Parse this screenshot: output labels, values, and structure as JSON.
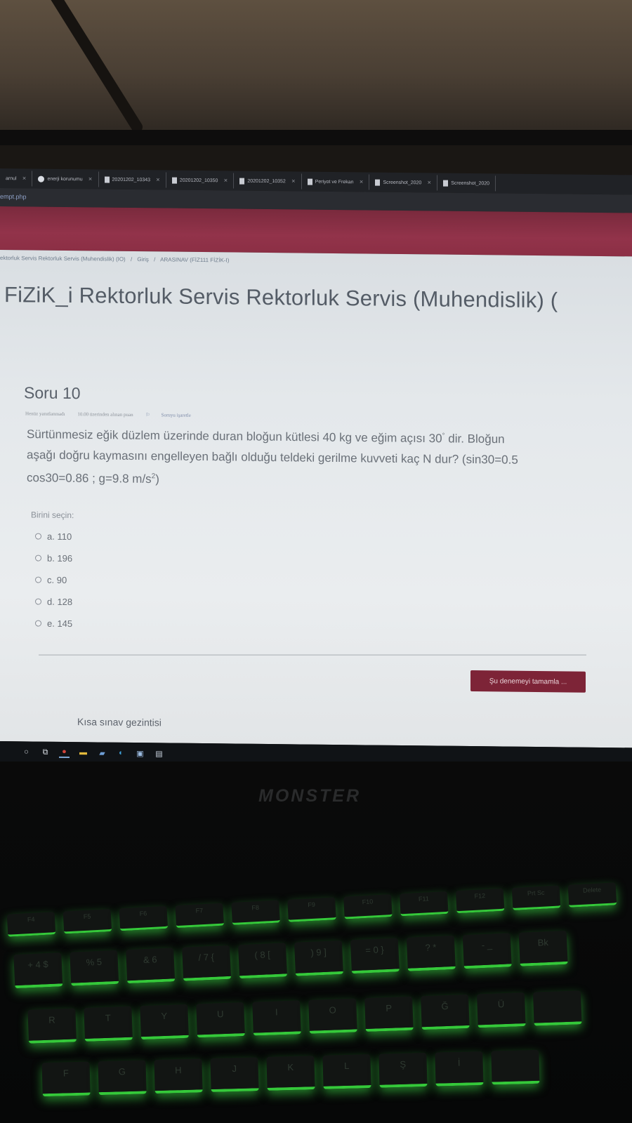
{
  "browser": {
    "tabs": [
      {
        "label": "arnul"
      },
      {
        "label": "enerji korunumu"
      },
      {
        "label": "20201202_10343"
      },
      {
        "label": "20201202_10350"
      },
      {
        "label": "20201202_10352"
      },
      {
        "label": "Periyot ve Frekan"
      },
      {
        "label": "Screenshot_2020"
      },
      {
        "label": "Screenshot_2020"
      }
    ],
    "url": "empt.php"
  },
  "breadcrumb": [
    "ektorluk Servis Rektorluk Servis (Muhendislik) (IO)",
    "/",
    "Giriş",
    "/",
    "ARASINAV (FİZ111 FİZİK-I)"
  ],
  "course_title": "FiZiK_i Rektorluk Servis Rektorluk Servis (Muhendislik) (",
  "question": {
    "number_label": "Soru 10",
    "status": "Henüz yanıtlanmadı",
    "points": "10.00 üzerinden alınan puan",
    "flag_label": "Soruyu işaretle",
    "text_line1": "Sürtünmesiz eğik düzlem üzerinde duran bloğun kütlesi 40 kg ve eğim açısı 30",
    "degree": "°",
    "text_line1_end": " dir. Bloğun",
    "text_line2": "aşağı doğru kaymasını engelleyen bağlı olduğu teldeki gerilme kuvveti kaç N dur? (sin30=0.5",
    "text_line3": "cos30=0.86 ;  g=9.8 m/s",
    "superscript": "2",
    "text_line3_end": ")",
    "choose_label": "Birini seçin:",
    "options": [
      {
        "label": "a. 110"
      },
      {
        "label": "b. 196"
      },
      {
        "label": "c. 90"
      },
      {
        "label": "d. 128"
      },
      {
        "label": "e. 145"
      }
    ]
  },
  "finish_button": "Şu denemeyi tamamla ...",
  "quiz_nav_label": "Kısa sınav gezintisi",
  "laptop": {
    "logo": "MONSTER",
    "fn_keys": [
      "F4",
      "F5",
      "F6",
      "F7",
      "F8",
      "F9",
      "F10",
      "F11",
      "F12",
      "Prt Sc",
      "Delete"
    ],
    "number_keys": [
      "+ 4 $",
      "% 5",
      "& 6",
      "/ 7 {",
      "( 8 [",
      ") 9 ]",
      "= 0 }",
      "? *",
      "- _",
      "Bk"
    ],
    "letter_keys": [
      "R",
      "T",
      "Y",
      "U",
      "I",
      "O",
      "P",
      "Ğ",
      "Ü",
      ""
    ],
    "home_keys": [
      "F",
      "G",
      "H",
      "J",
      "K",
      "L",
      "Ş",
      "İ",
      ""
    ]
  }
}
